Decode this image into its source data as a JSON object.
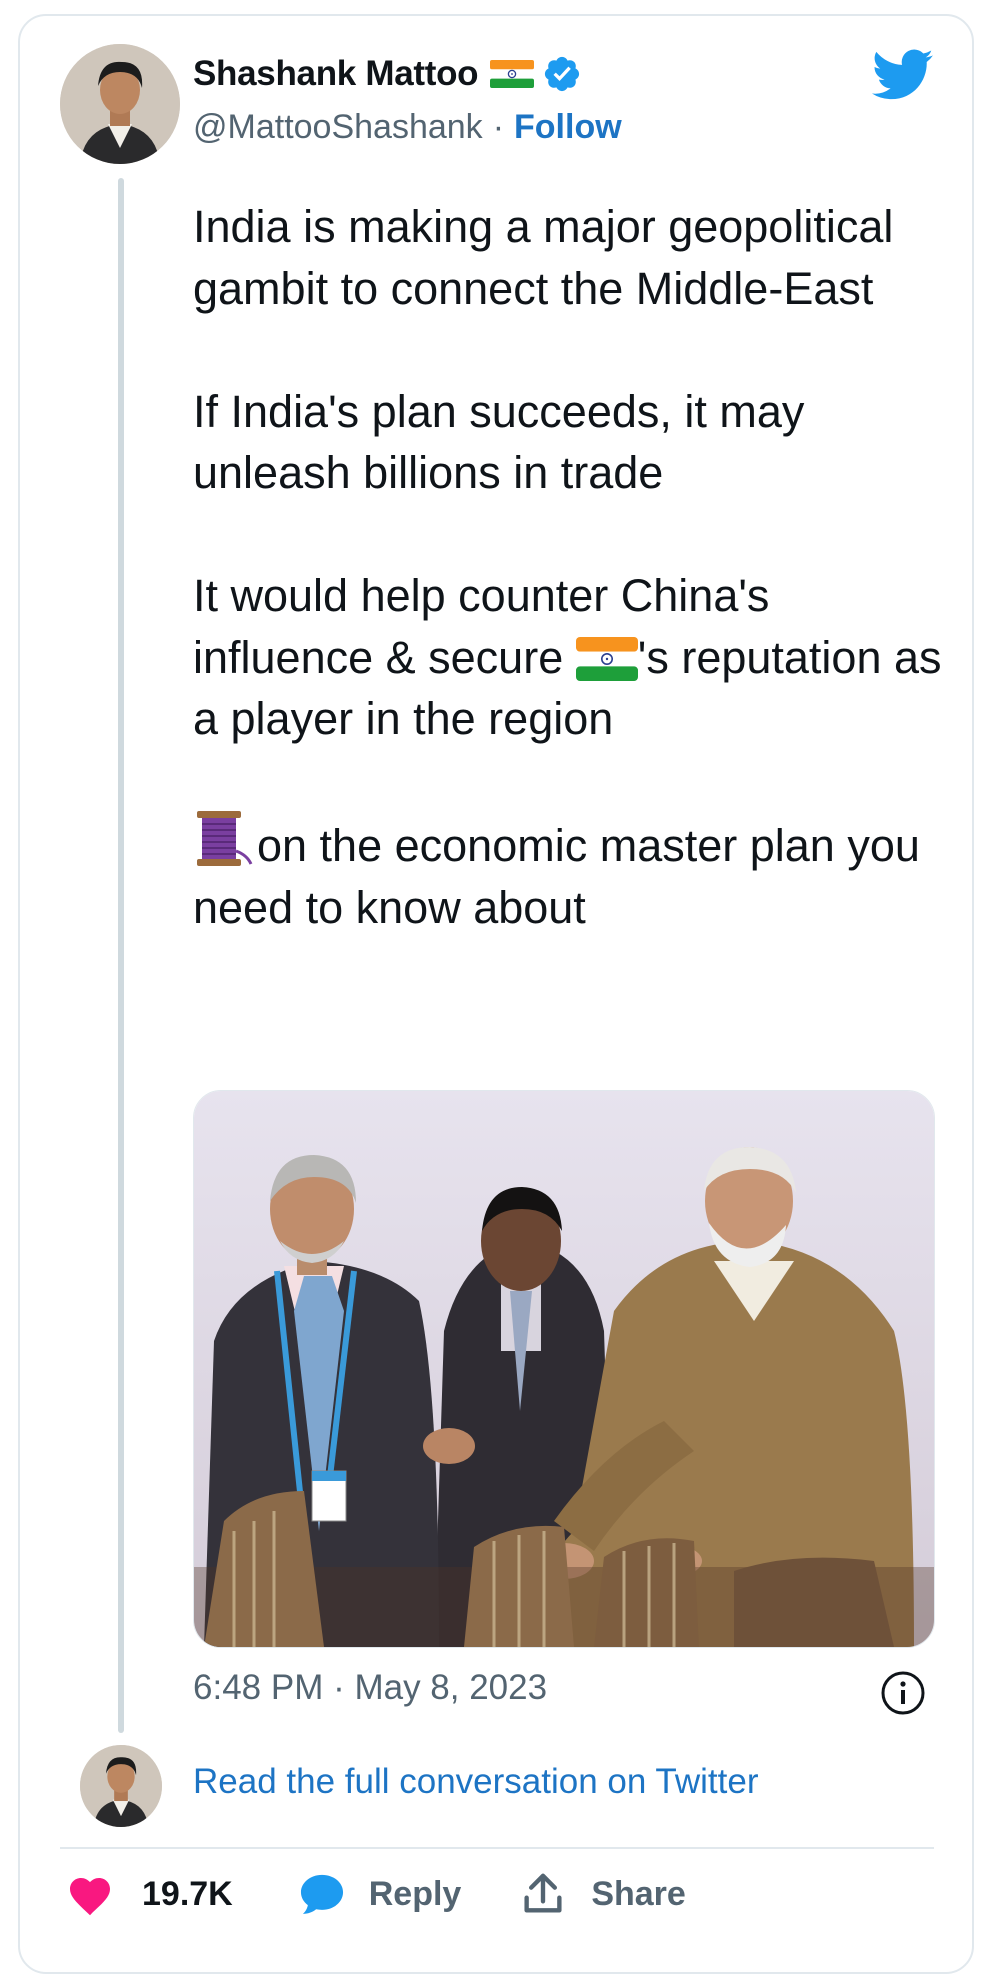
{
  "author": {
    "name": "Shashank Mattoo",
    "handle": "@MattooShashank",
    "separator": "·",
    "follow_label": "Follow",
    "verified": true,
    "name_emoji": "india-flag-icon"
  },
  "tweet": {
    "paragraphs": {
      "p1": "India is making a major geopolitical gambit to connect the Middle-East",
      "p2": "If India's plan succeeds, it may unleash billions in trade",
      "p3_before": "It would help counter China's influence & secure ",
      "p3_after": "'s reputation as a player in the region",
      "p4": "on the economic master plan you need to know about"
    },
    "inline_emojis": [
      "india-flag-icon",
      "thread-spool-icon"
    ],
    "timestamp": "6:48 PM · May 8, 2023"
  },
  "footer": {
    "read_full_label": "Read the full conversation on Twitter",
    "likes": "19.7K",
    "reply_label": "Reply",
    "share_label": "Share"
  },
  "colors": {
    "link_blue": "#1d74c4",
    "twitter_blue": "#1d9bf0",
    "like_pink": "#f91880",
    "text_gray": "#536471",
    "border": "#e1e8ed"
  }
}
